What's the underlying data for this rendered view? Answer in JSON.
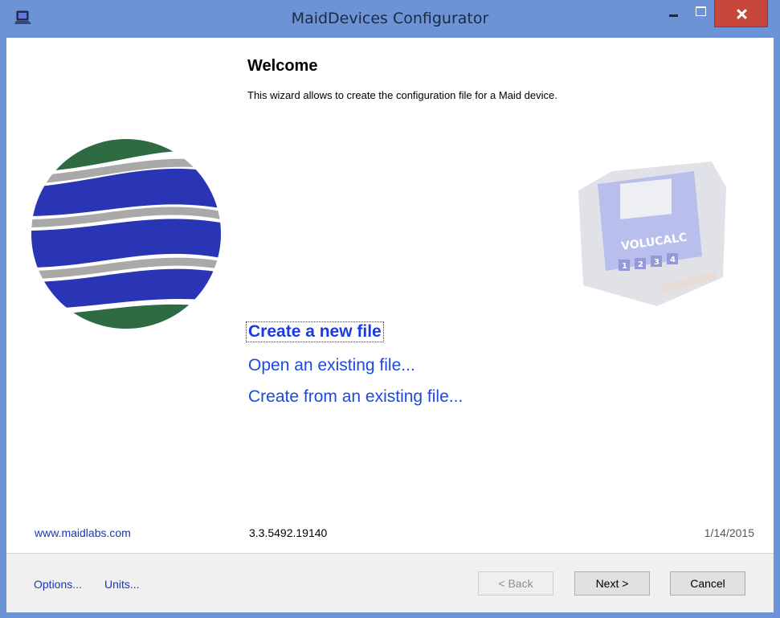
{
  "window": {
    "title": "MaidDevices Configurator"
  },
  "header": {
    "title": "Welcome",
    "description": "This wizard allows to create the configuration file for a Maid device."
  },
  "actions": {
    "create_new": "Create a new file",
    "open_existing": "Open an existing file...",
    "create_from_existing": "Create from an existing file..."
  },
  "info": {
    "website": "www.maidlabs.com",
    "version": "3.3.5492.19140",
    "date": "1/14/2015"
  },
  "footer": {
    "options_label": "Options...",
    "units_label": "Units...",
    "back_label": "< Back",
    "next_label": "Next >",
    "cancel_label": "Cancel"
  },
  "device": {
    "brand_text": "VOLUCALC",
    "keys": [
      "1",
      "2",
      "3",
      "4"
    ]
  },
  "colors": {
    "accent_link": "#1a4ae0",
    "logo_blue": "#2a35b5",
    "logo_green": "#2e6b43",
    "close_red": "#c7463b",
    "titlebar": "#6b93d6"
  }
}
